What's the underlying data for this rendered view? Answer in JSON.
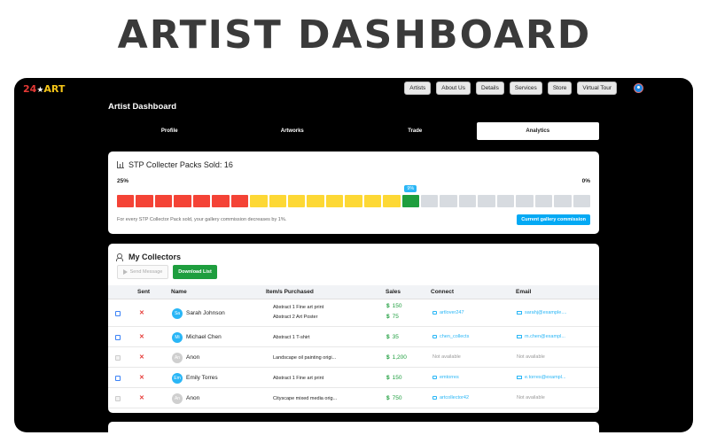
{
  "hero": {
    "title": "ARTIST DASHBOARD"
  },
  "logo": {
    "part1": "24",
    "part2": "ART",
    "star": "★"
  },
  "nav": {
    "items": [
      "Artists",
      "About Us",
      "Details",
      "Services",
      "Store",
      "Virtual Tour"
    ]
  },
  "page": {
    "title": "Artist Dashboard"
  },
  "tabs": [
    {
      "label": "Profile",
      "active": false
    },
    {
      "label": "Artworks",
      "active": false
    },
    {
      "label": "Trade",
      "active": false
    },
    {
      "label": "Analytics",
      "active": true
    }
  ],
  "packs": {
    "title": "STP Collecter Packs Sold: 16",
    "start_label": "25%",
    "end_label": "0%",
    "current_marker": "9%",
    "segment_colors": [
      "#f44336",
      "#f44336",
      "#f44336",
      "#f44336",
      "#f44336",
      "#f44336",
      "#f44336",
      "#fdd835",
      "#fdd835",
      "#fdd835",
      "#fdd835",
      "#fdd835",
      "#fdd835",
      "#fdd835",
      "#fdd835",
      "#1e9e3e",
      "#d7dbe0",
      "#d7dbe0",
      "#d7dbe0",
      "#d7dbe0",
      "#d7dbe0",
      "#d7dbe0",
      "#d7dbe0",
      "#d7dbe0",
      "#d7dbe0"
    ],
    "note": "For every STP Collector Pack sold, your gallery commission decreases by 1%.",
    "commission_button": "Current gallery commission"
  },
  "collectors": {
    "title": "My Collectors",
    "send_label": "Send Message",
    "download_label": "Download List",
    "headers": {
      "sent": "Sent",
      "name": "Name",
      "items": "Item/s Purchased",
      "sales": "Sales",
      "connect": "Connect",
      "email": "Email"
    },
    "rows": [
      {
        "initials": "Sa",
        "name": "Sarah Johnson",
        "items": [
          "Abstract 1 Fine art print",
          "Abstract 2 Art Poster"
        ],
        "sales": [
          "150",
          "75"
        ],
        "connect": "artlover247",
        "email": "sarahj@example....",
        "active": true
      },
      {
        "initials": "Mi",
        "name": "Michael Chen",
        "items": [
          "Abstract 1 T-shirt"
        ],
        "sales": [
          "35"
        ],
        "connect": "chen_collects",
        "email": "m.chen@exampl...",
        "active": true
      },
      {
        "initials": "An",
        "name": "Anon",
        "items": [
          "Landscape oil painting origi..."
        ],
        "sales": [
          "1,200"
        ],
        "connect": "Not available",
        "email": "Not available",
        "active": false
      },
      {
        "initials": "Em",
        "name": "Emily Torres",
        "items": [
          "Abstract 1 Fine art print"
        ],
        "sales": [
          "150"
        ],
        "connect": "emtorres",
        "email": "e.torres@exampl...",
        "active": true
      },
      {
        "initials": "An",
        "name": "Anon",
        "items": [
          "Cityscape mixed media orig..."
        ],
        "sales": [
          "750"
        ],
        "connect": "artcollector42",
        "email": "Not available",
        "active": false
      }
    ],
    "currency": "$",
    "sent_mark": "✕"
  }
}
